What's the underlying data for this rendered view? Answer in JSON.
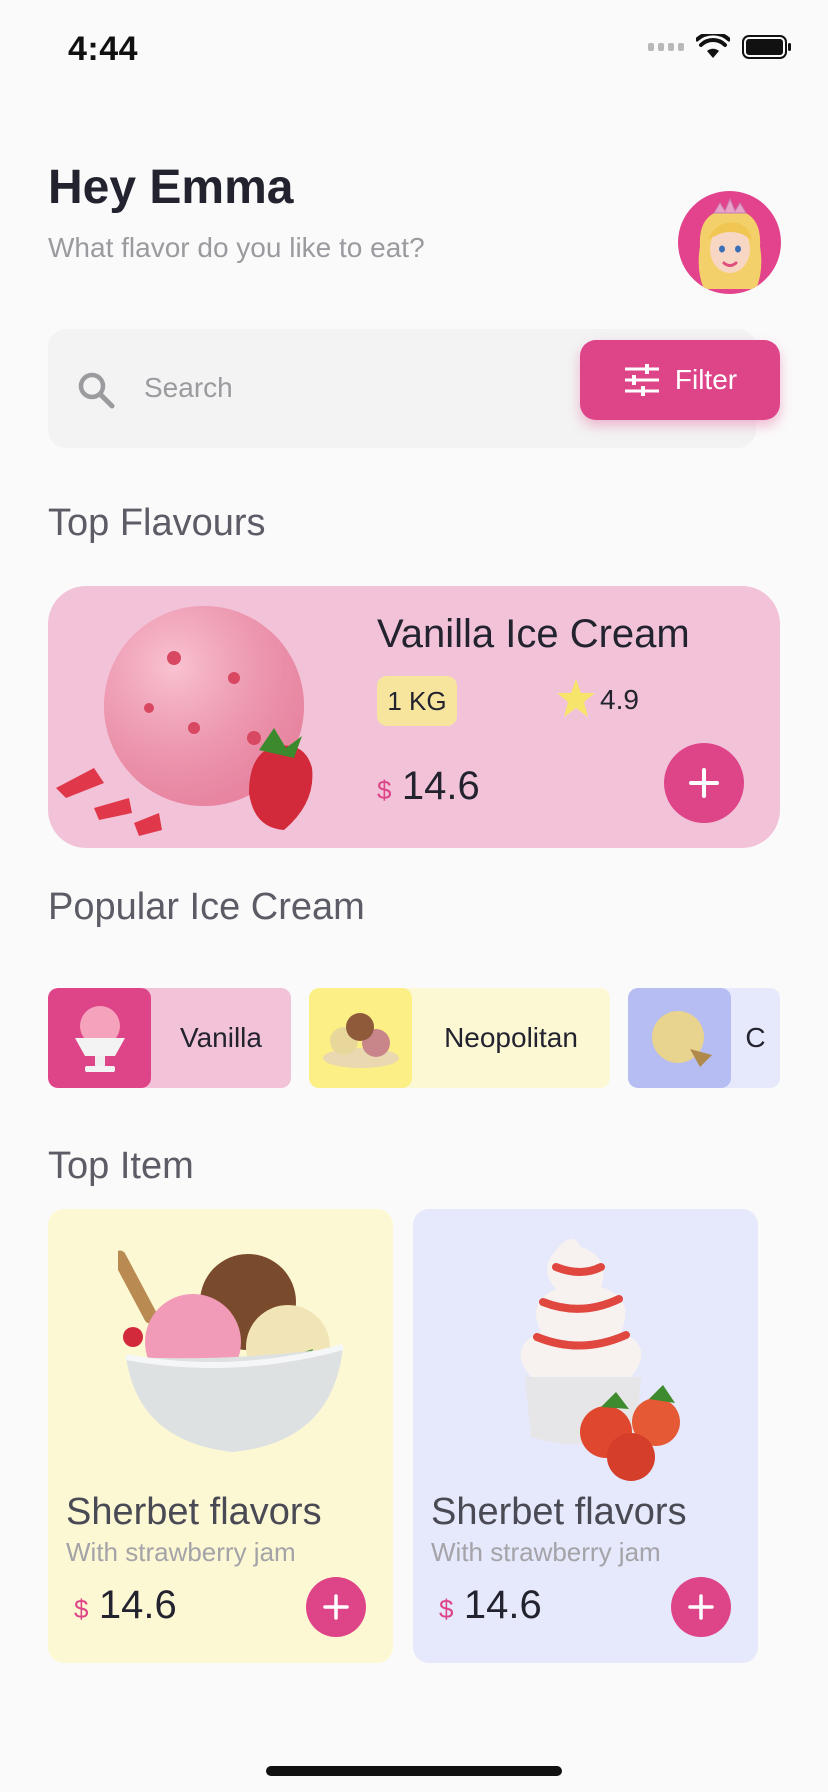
{
  "status_bar": {
    "time": "4:44"
  },
  "header": {
    "greeting": "Hey Emma",
    "subtitle": "What flavor do you like to eat?",
    "avatar_icon": "princess-avatar"
  },
  "search": {
    "placeholder": "Search",
    "filter_label": "Filter"
  },
  "sections": {
    "top_flavours": "Top Flavours",
    "popular": "Popular Ice Cream",
    "top_item": "Top Item"
  },
  "top_flavour": {
    "name": "Vanilla Ice Cream",
    "weight": "1 KG",
    "rating": "4.9",
    "currency": "$",
    "price": "14.6"
  },
  "popular_items": [
    {
      "label": "Vanilla",
      "thumb_color": "#de4488",
      "bg_color": "#f2c3d8"
    },
    {
      "label": "Neopolitan",
      "thumb_color": "#fbef86",
      "bg_color": "#fdf8d4"
    },
    {
      "label": "C",
      "thumb_color": "#b5bdf2",
      "bg_color": "#e6e8fb"
    }
  ],
  "top_items": [
    {
      "title": "Sherbet flavors",
      "subtitle": "With strawberry jam",
      "currency": "$",
      "price": "14.6",
      "bg_color": "#fdf8d4"
    },
    {
      "title": "Sherbet flavors",
      "subtitle": "With strawberry jam",
      "currency": "$",
      "price": "14.6",
      "bg_color": "#e6e8fb"
    }
  ],
  "colors": {
    "accent": "#de4488",
    "background": "#fafafa"
  }
}
